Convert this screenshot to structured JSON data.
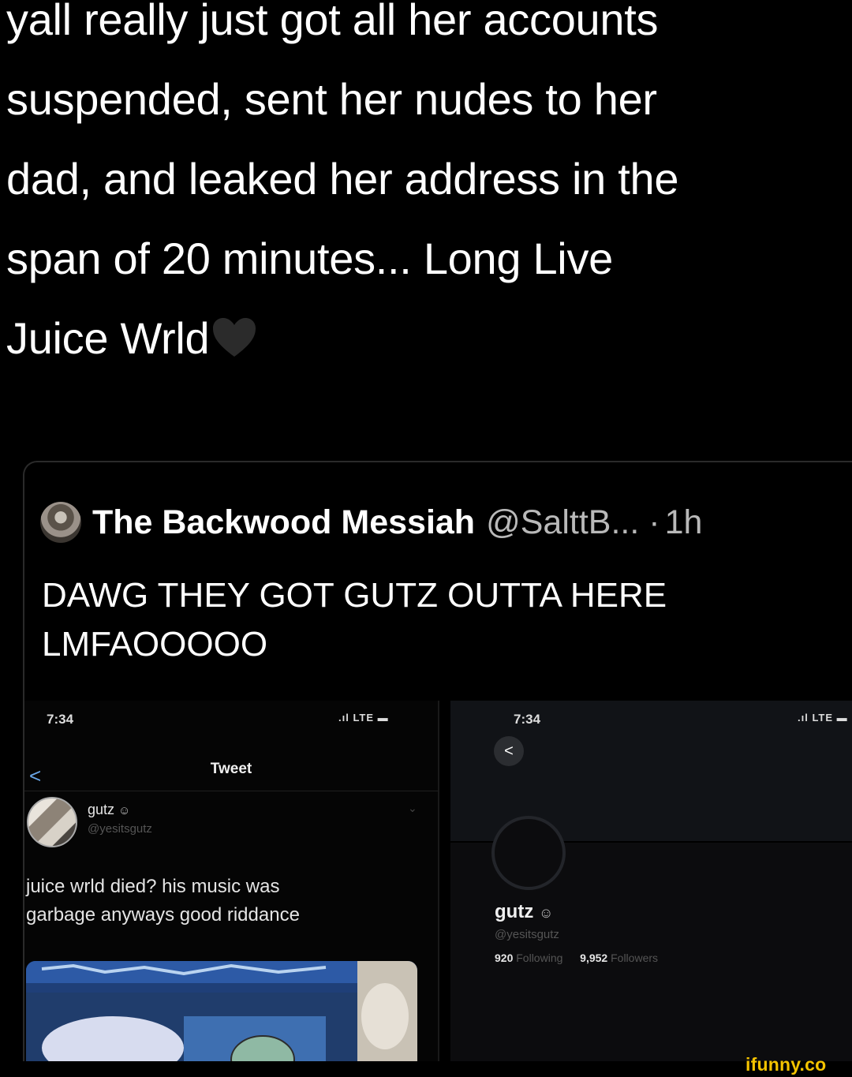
{
  "main_tweet": {
    "lines": [
      "yall really just got all her accounts",
      "suspended, sent her nudes to her",
      "dad, and leaked her address in the",
      "span of 20 minutes... Long Live",
      "Juice Wrld"
    ],
    "emoji": "black-heart-icon"
  },
  "quoted_tweet": {
    "name": "The Backwood Messiah",
    "handle": "@SalttB...",
    "separator": "·",
    "time": "1h",
    "text_line1": "DAWG THEY GOT GUTZ OUTTA HERE",
    "text_line2": "LMFAOOOOO"
  },
  "left_screenshot": {
    "status_time": "7:34",
    "status_icons": ".ıl LTE ▬",
    "title": "Tweet",
    "back": "<",
    "username": "gutz",
    "handle": "@yesitsgutz",
    "chevron": "⌄",
    "text_line1": "juice wrld died? his music was",
    "text_line2": "garbage anyways good riddance"
  },
  "right_screenshot": {
    "status_time": "7:34",
    "status_icons": ".ıl LTE ▬",
    "back": "<",
    "more": "•••",
    "username": "gutz",
    "handle": "@yesitsgutz",
    "following_count": "920",
    "following_label": "Following",
    "followers_count": "9,952",
    "followers_label": "Followers"
  },
  "watermark": "ifunny.co",
  "colors": {
    "background": "#000000",
    "text": "#ffffff",
    "secondary_text": "#b9b9b9",
    "link_blue": "#6aa7e8",
    "watermark": "#f4c300"
  }
}
